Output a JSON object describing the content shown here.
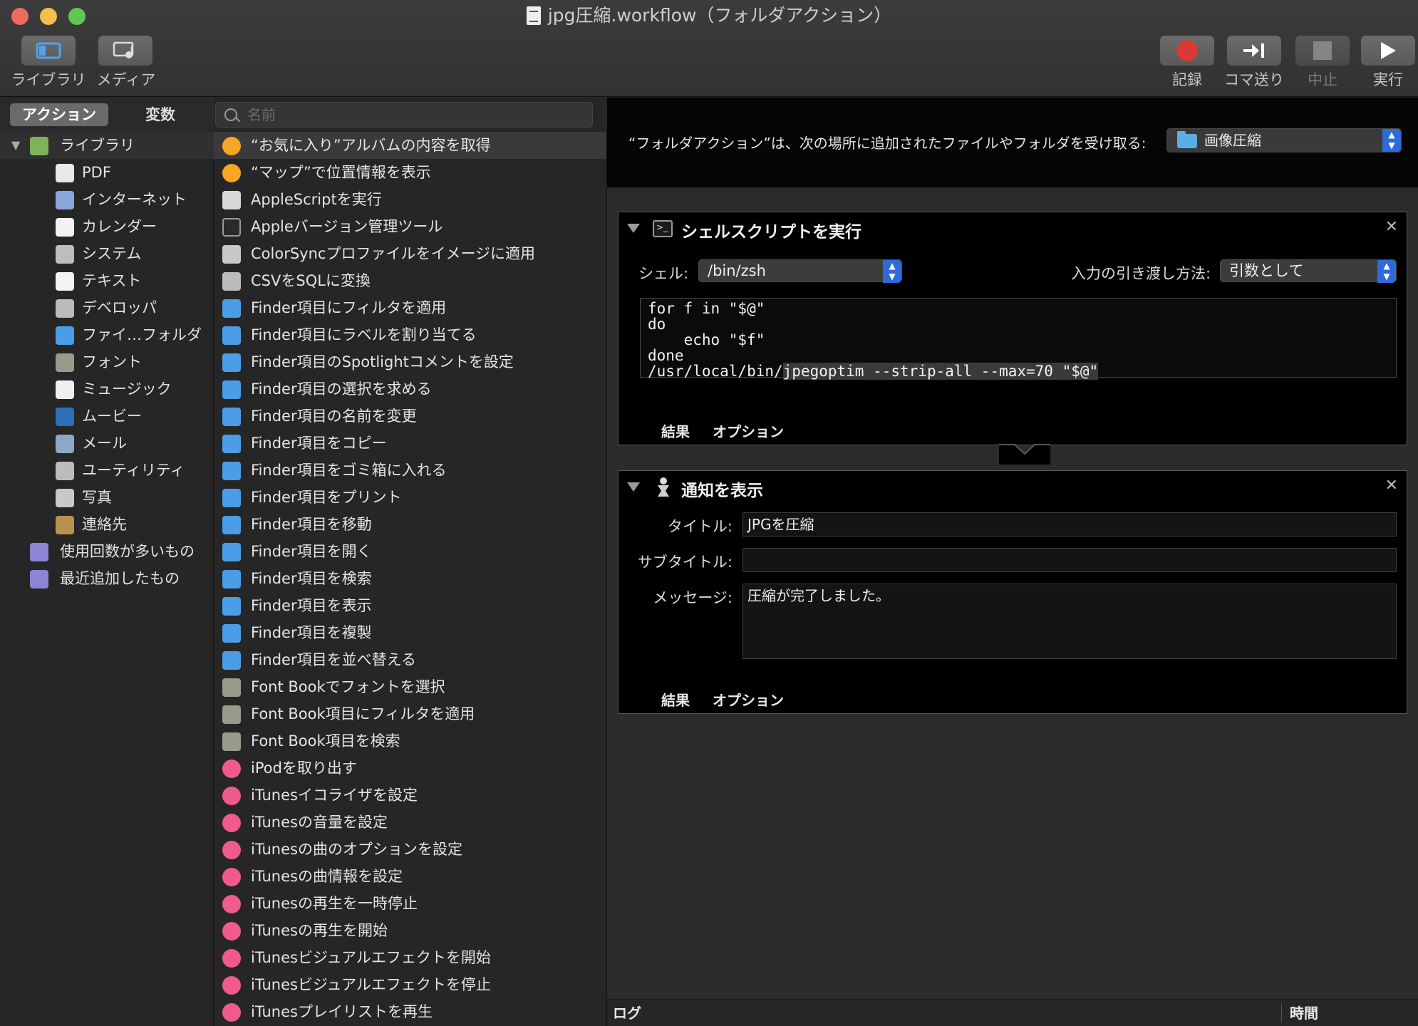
{
  "window": {
    "title": "jpg圧縮.workflow（フォルダアクション）"
  },
  "toolbar": {
    "left": [
      {
        "label": "ライブラリ",
        "icon": "library-icon"
      },
      {
        "label": "メディア",
        "icon": "media-icon"
      }
    ],
    "right": [
      {
        "label": "記録",
        "icon": "record-icon"
      },
      {
        "label": "コマ送り",
        "icon": "step-icon"
      },
      {
        "label": "中止",
        "icon": "stop-icon"
      },
      {
        "label": "実行",
        "icon": "run-icon"
      }
    ]
  },
  "tabs": {
    "actions": "アクション",
    "variables": "変数"
  },
  "search": {
    "placeholder": "名前"
  },
  "categories": [
    {
      "label": "ライブラリ",
      "icon": "library-folder-icon",
      "color": "#7fb35a"
    },
    {
      "label": "PDF",
      "icon": "pdf-icon",
      "color": "#e8e8e8"
    },
    {
      "label": "インターネット",
      "icon": "globe-icon",
      "color": "#8aa6d8"
    },
    {
      "label": "カレンダー",
      "icon": "calendar-icon",
      "color": "#f2f2f2"
    },
    {
      "label": "システム",
      "icon": "system-icon",
      "color": "#bdbdbd"
    },
    {
      "label": "テキスト",
      "icon": "text-icon",
      "color": "#f4f4f4"
    },
    {
      "label": "デベロッパ",
      "icon": "developer-icon",
      "color": "#bcbcbc"
    },
    {
      "label": "ファイ…フォルダ",
      "icon": "finder-icon",
      "color": "#4a9de6"
    },
    {
      "label": "フォント",
      "icon": "font-icon",
      "color": "#9a9a8a"
    },
    {
      "label": "ミュージック",
      "icon": "music-icon",
      "color": "#f0f0f0"
    },
    {
      "label": "ムービー",
      "icon": "movie-icon",
      "color": "#2b6fb8"
    },
    {
      "label": "メール",
      "icon": "mail-icon",
      "color": "#8aa8c8"
    },
    {
      "label": "ユーティリティ",
      "icon": "utility-icon",
      "color": "#bcbcbc"
    },
    {
      "label": "写真",
      "icon": "photo-icon",
      "color": "#c8c8c8"
    },
    {
      "label": "連絡先",
      "icon": "contacts-icon",
      "color": "#b8914f"
    },
    {
      "label": "使用回数が多いもの",
      "icon": "smart-folder-icon",
      "color": "#8c84d4"
    },
    {
      "label": "最近追加したもの",
      "icon": "smart-folder-icon",
      "color": "#8c84d4"
    }
  ],
  "actions": [
    {
      "label": "“お気に入り”アルバムの内容を取得",
      "icon": "photos-icon",
      "color": "#f5a623"
    },
    {
      "label": "“マップ”で位置情報を表示",
      "icon": "photos-icon",
      "color": "#f5a623"
    },
    {
      "label": "AppleScriptを実行",
      "icon": "script-icon",
      "color": "#d8d8d8"
    },
    {
      "label": "Appleバージョン管理ツール",
      "icon": "terminal-icon",
      "color": "#2a2a2a"
    },
    {
      "label": "ColorSyncプロファイルをイメージに適用",
      "icon": "colorsync-icon",
      "color": "#c8c8c8"
    },
    {
      "label": "CSVをSQLに変換",
      "icon": "tools-icon",
      "color": "#bcbcbc"
    },
    {
      "label": "Finder項目にフィルタを適用",
      "icon": "finder-icon",
      "color": "#4a9de6"
    },
    {
      "label": "Finder項目にラベルを割り当てる",
      "icon": "finder-icon",
      "color": "#4a9de6"
    },
    {
      "label": "Finder項目のSpotlightコメントを設定",
      "icon": "finder-icon",
      "color": "#4a9de6"
    },
    {
      "label": "Finder項目の選択を求める",
      "icon": "finder-icon",
      "color": "#4a9de6"
    },
    {
      "label": "Finder項目の名前を変更",
      "icon": "finder-icon",
      "color": "#4a9de6"
    },
    {
      "label": "Finder項目をコピー",
      "icon": "finder-icon",
      "color": "#4a9de6"
    },
    {
      "label": "Finder項目をゴミ箱に入れる",
      "icon": "finder-icon",
      "color": "#4a9de6"
    },
    {
      "label": "Finder項目をプリント",
      "icon": "finder-icon",
      "color": "#4a9de6"
    },
    {
      "label": "Finder項目を移動",
      "icon": "finder-icon",
      "color": "#4a9de6"
    },
    {
      "label": "Finder項目を開く",
      "icon": "finder-icon",
      "color": "#4a9de6"
    },
    {
      "label": "Finder項目を検索",
      "icon": "finder-icon",
      "color": "#4a9de6"
    },
    {
      "label": "Finder項目を表示",
      "icon": "finder-icon",
      "color": "#4a9de6"
    },
    {
      "label": "Finder項目を複製",
      "icon": "finder-icon",
      "color": "#4a9de6"
    },
    {
      "label": "Finder項目を並べ替える",
      "icon": "finder-icon",
      "color": "#4a9de6"
    },
    {
      "label": "Font Bookでフォントを選択",
      "icon": "font-book-icon",
      "color": "#9a9a8a"
    },
    {
      "label": "Font Book項目にフィルタを適用",
      "icon": "font-book-icon",
      "color": "#9a9a8a"
    },
    {
      "label": "Font Book項目を検索",
      "icon": "font-book-icon",
      "color": "#9a9a8a"
    },
    {
      "label": "iPodを取り出す",
      "icon": "itunes-icon",
      "color": "#f05a8c"
    },
    {
      "label": "iTunesイコライザを設定",
      "icon": "itunes-icon",
      "color": "#f05a8c"
    },
    {
      "label": "iTunesの音量を設定",
      "icon": "itunes-icon",
      "color": "#f05a8c"
    },
    {
      "label": "iTunesの曲のオプションを設定",
      "icon": "itunes-icon",
      "color": "#f05a8c"
    },
    {
      "label": "iTunesの曲情報を設定",
      "icon": "itunes-icon",
      "color": "#f05a8c"
    },
    {
      "label": "iTunesの再生を一時停止",
      "icon": "itunes-icon",
      "color": "#f05a8c"
    },
    {
      "label": "iTunesの再生を開始",
      "icon": "itunes-icon",
      "color": "#f05a8c"
    },
    {
      "label": "iTunesビジュアルエフェクトを開始",
      "icon": "itunes-icon",
      "color": "#f05a8c"
    },
    {
      "label": "iTunesビジュアルエフェクトを停止",
      "icon": "itunes-icon",
      "color": "#f05a8c"
    },
    {
      "label": "iTunesプレイリストを再生",
      "icon": "itunes-icon",
      "color": "#f05a8c"
    }
  ],
  "folder_action": {
    "label": "“フォルダアクション”は、次の場所に追加されたファイルやフォルダを受け取る:",
    "folder": "画像圧縮"
  },
  "shell_action": {
    "title": "シェルスクリプトを実行",
    "shell_label": "シェル:",
    "shell_value": "/bin/zsh",
    "input_label": "入力の引き渡し方法:",
    "input_value": "引数として",
    "code_lines": [
      "for f in \"$@\"",
      "do",
      "    echo \"$f\"",
      "done"
    ],
    "code_last_prefix": "/usr/local/bin/",
    "code_last_highlight": "jpegoptim --strip-all --max=70 \"$@\"",
    "tab_results": "結果",
    "tab_options": "オプション"
  },
  "notify_action": {
    "title": "通知を表示",
    "title_label": "タイトル:",
    "title_value": "JPGを圧縮",
    "subtitle_label": "サブタイトル:",
    "subtitle_value": "",
    "message_label": "メッセージ:",
    "message_value": "圧縮が完了しました。",
    "tab_results": "結果",
    "tab_options": "オプション"
  },
  "log": {
    "log_label": "ログ",
    "time_label": "時間"
  },
  "colors": {
    "accent": "#2f6ad9",
    "record": "#d93a35",
    "close": "#ed6a5e",
    "minimize": "#f5bf4f",
    "zoom": "#61c554"
  }
}
